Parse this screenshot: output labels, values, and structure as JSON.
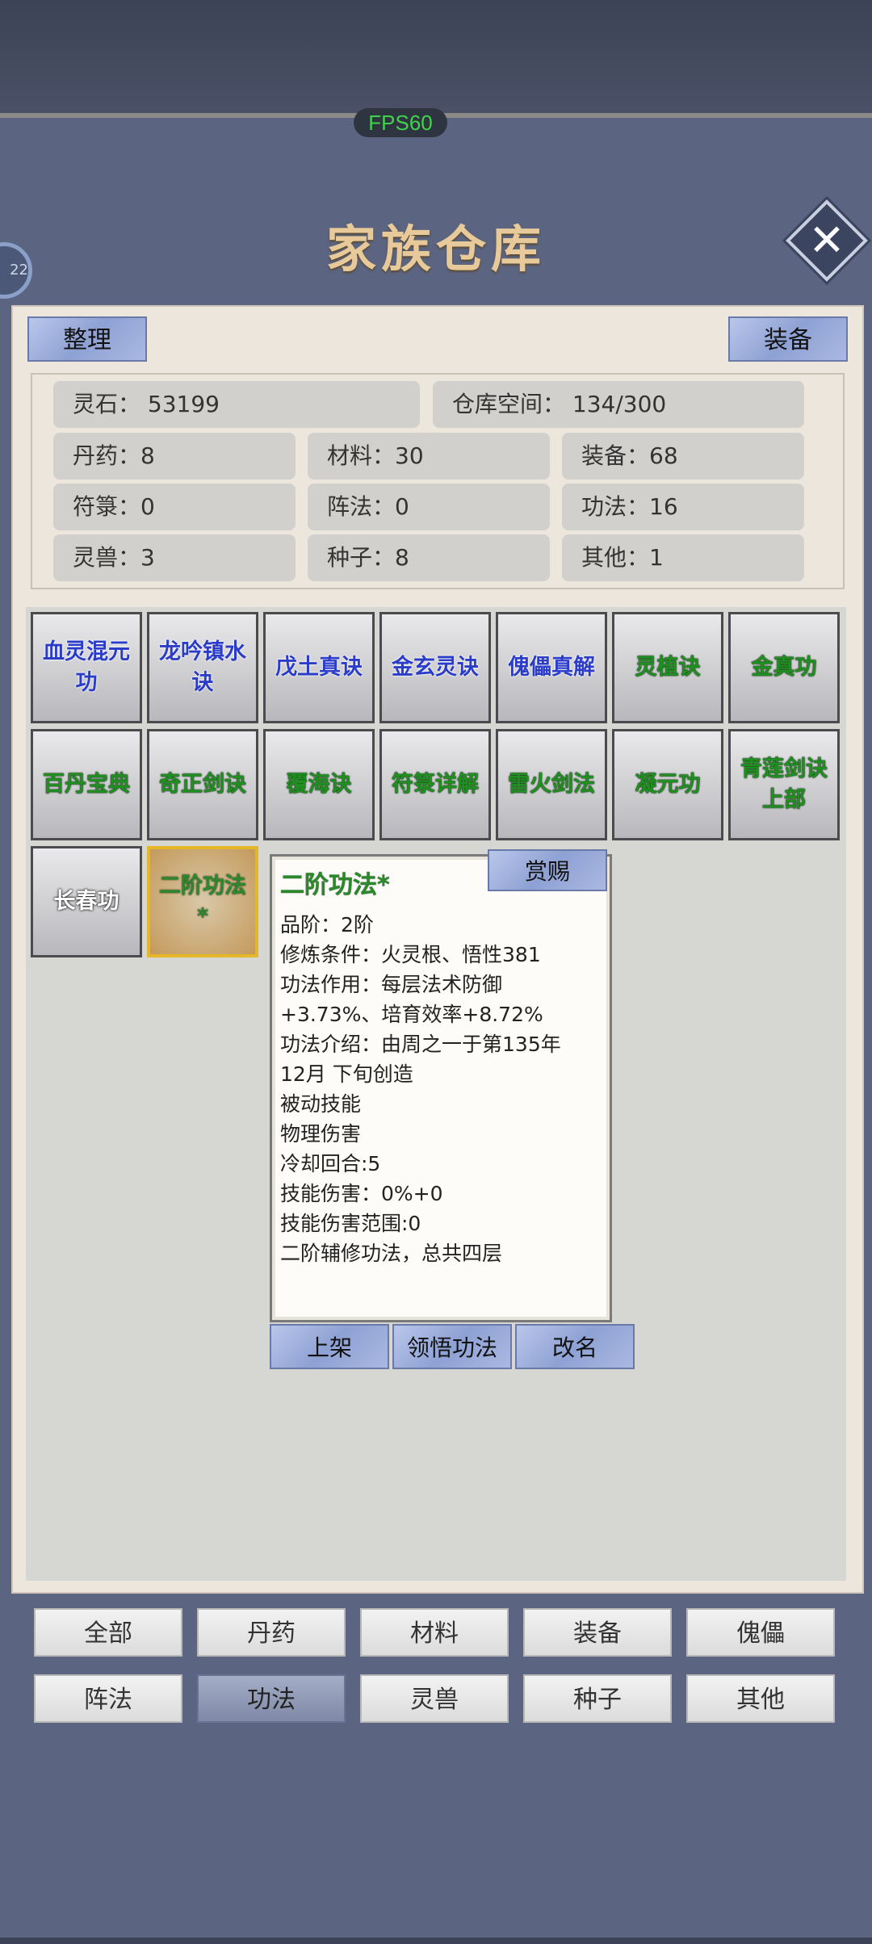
{
  "fps": "FPS60",
  "avatar_badge": "22",
  "title": "家族仓库",
  "close_icon": "close-icon",
  "buttons": {
    "sort": "整理",
    "equip": "装备"
  },
  "stats": {
    "lingshi": "灵石：  53199",
    "space": "仓库空间：   134/300",
    "row2": [
      "丹药：8",
      "材料：30",
      "装备：68"
    ],
    "row3": [
      "符箓：0",
      "阵法：0",
      "功法：16"
    ],
    "row4": [
      "灵兽：3",
      "种子：8",
      "其他：1"
    ]
  },
  "items": [
    {
      "name": "血灵混元功",
      "color": "blue"
    },
    {
      "name": "龙吟镇水诀",
      "color": "blue"
    },
    {
      "name": "戊土真诀",
      "color": "blue"
    },
    {
      "name": "金玄灵诀",
      "color": "blue"
    },
    {
      "name": "傀儡真解",
      "color": "blue"
    },
    {
      "name": "灵植诀",
      "color": "green"
    },
    {
      "name": "金真功",
      "color": "green"
    },
    {
      "name": "百丹宝典",
      "color": "green"
    },
    {
      "name": "奇正剑诀",
      "color": "green"
    },
    {
      "name": "覆海诀",
      "color": "green"
    },
    {
      "name": "符箓详解",
      "color": "green"
    },
    {
      "name": "雷火剑法",
      "color": "green"
    },
    {
      "name": "凝元功",
      "color": "green"
    },
    {
      "name": "青莲剑诀上部",
      "color": "green"
    },
    {
      "name": "长春功",
      "color": "white"
    },
    {
      "name": "二阶功法*",
      "color": "selected"
    }
  ],
  "tooltip": {
    "title": "二阶功法*",
    "reward_label": "赏赐",
    "lines": [
      "品阶：2阶",
      "修炼条件：火灵根、悟性381",
      "功法作用：每层法术防御",
      "+3.73%、培育效率+8.72%",
      "功法介绍：由周之一于第135年",
      "12月 下旬创造",
      "被动技能",
      "物理伤害",
      "冷却回合:5",
      "技能伤害：0%+0",
      "技能伤害范围:0",
      "二阶辅修功法，总共四层"
    ],
    "actions": [
      "上架",
      "领悟功法",
      "改名"
    ]
  },
  "categories": [
    {
      "label": "全部"
    },
    {
      "label": "丹药"
    },
    {
      "label": "材料"
    },
    {
      "label": "装备"
    },
    {
      "label": "傀儡"
    },
    {
      "label": "阵法"
    },
    {
      "label": "功法",
      "active": true
    },
    {
      "label": "灵兽"
    },
    {
      "label": "种子"
    },
    {
      "label": "其他"
    }
  ]
}
